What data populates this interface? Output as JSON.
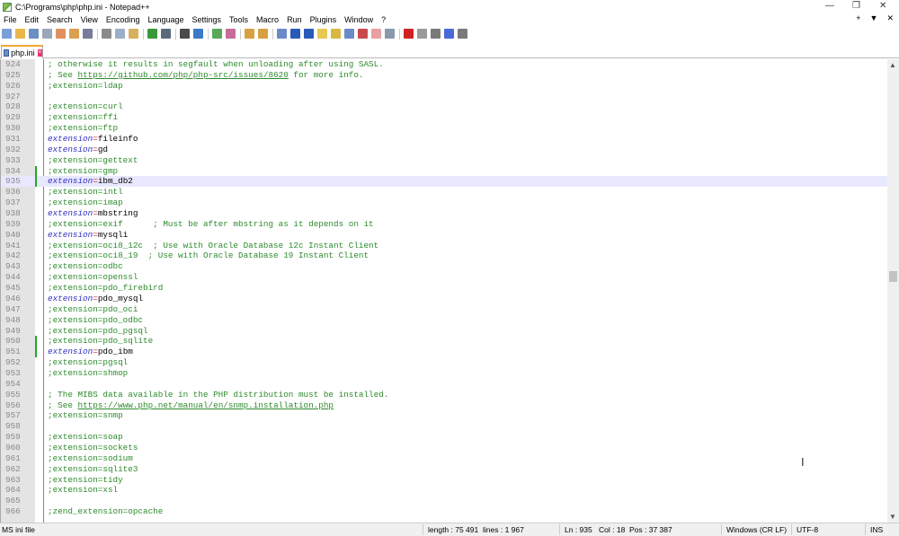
{
  "window": {
    "title": "C:\\Programs\\php\\php.ini - Notepad++",
    "controls": [
      "—",
      "❐",
      "✕"
    ]
  },
  "menu": {
    "items": [
      "File",
      "Edit",
      "Search",
      "View",
      "Encoding",
      "Language",
      "Settings",
      "Tools",
      "Macro",
      "Run",
      "Plugins",
      "Window",
      "?"
    ],
    "right": [
      "+",
      "▼",
      "✕"
    ]
  },
  "toolbar": {
    "icons": [
      "new-file",
      "open-file",
      "save",
      "save-all",
      "close",
      "close-all",
      "print",
      "|",
      "cut",
      "copy",
      "paste",
      "|",
      "undo",
      "redo",
      "|",
      "find",
      "replace",
      "|",
      "zoom-in",
      "zoom-out",
      "|",
      "sync-vertical",
      "sync-horizontal",
      "|",
      "word-wrap",
      "show-all-characters",
      "indent-guide",
      "user-defined-language",
      "document-map",
      "function-list",
      "folder-as-workspace",
      "document-list",
      "monitoring",
      "|",
      "record-macro",
      "stop-recording",
      "playback-macro",
      "run-macro-multiple",
      "save-macro"
    ]
  },
  "tab": {
    "label": "php.ini"
  },
  "editor": {
    "current_line": 935,
    "lines": [
      {
        "n": "924",
        "kind": "comment",
        "text": "; otherwise it results in segfault when unloading after using SASL."
      },
      {
        "n": "925",
        "kind": "comment_url",
        "pre": "; See ",
        "url": "https://github.com/php/php-src/issues/8620",
        "post": " for more info."
      },
      {
        "n": "926",
        "kind": "comment",
        "text": ";extension=ldap"
      },
      {
        "n": "927",
        "kind": "blank",
        "text": ""
      },
      {
        "n": "928",
        "kind": "comment",
        "text": ";extension=curl"
      },
      {
        "n": "929",
        "kind": "comment",
        "text": ";extension=ffi"
      },
      {
        "n": "930",
        "kind": "comment",
        "text": ";extension=ftp"
      },
      {
        "n": "931",
        "kind": "active",
        "key": "extension",
        "value": "fileinfo"
      },
      {
        "n": "932",
        "kind": "active",
        "key": "extension",
        "value": "gd"
      },
      {
        "n": "933",
        "kind": "comment",
        "text": ";extension=gettext"
      },
      {
        "n": "934",
        "kind": "comment",
        "text": ";extension=gmp",
        "changed": true
      },
      {
        "n": "935",
        "kind": "active",
        "key": "extension",
        "value": "ibm_db2",
        "changed": true
      },
      {
        "n": "936",
        "kind": "comment",
        "text": ";extension=intl"
      },
      {
        "n": "937",
        "kind": "comment",
        "text": ";extension=imap"
      },
      {
        "n": "938",
        "kind": "active",
        "key": "extension",
        "value": "mbstring"
      },
      {
        "n": "939",
        "kind": "comment",
        "text": ";extension=exif      ; Must be after mbstring as it depends on it"
      },
      {
        "n": "940",
        "kind": "active",
        "key": "extension",
        "value": "mysqli"
      },
      {
        "n": "941",
        "kind": "comment",
        "text": ";extension=oci8_12c  ; Use with Oracle Database 12c Instant Client"
      },
      {
        "n": "942",
        "kind": "comment",
        "text": ";extension=oci8_19  ; Use with Oracle Database 19 Instant Client"
      },
      {
        "n": "943",
        "kind": "comment",
        "text": ";extension=odbc"
      },
      {
        "n": "944",
        "kind": "comment",
        "text": ";extension=openssl"
      },
      {
        "n": "945",
        "kind": "comment",
        "text": ";extension=pdo_firebird"
      },
      {
        "n": "946",
        "kind": "active",
        "key": "extension",
        "value": "pdo_mysql"
      },
      {
        "n": "947",
        "kind": "comment",
        "text": ";extension=pdo_oci"
      },
      {
        "n": "948",
        "kind": "comment",
        "text": ";extension=pdo_odbc"
      },
      {
        "n": "949",
        "kind": "comment",
        "text": ";extension=pdo_pgsql"
      },
      {
        "n": "950",
        "kind": "comment",
        "text": ";extension=pdo_sqlite",
        "changed": true
      },
      {
        "n": "951",
        "kind": "active",
        "key": "extension",
        "value": "pdo_ibm",
        "changed": true
      },
      {
        "n": "952",
        "kind": "comment",
        "text": ";extension=pgsql"
      },
      {
        "n": "953",
        "kind": "comment",
        "text": ";extension=shmop"
      },
      {
        "n": "954",
        "kind": "blank",
        "text": ""
      },
      {
        "n": "955",
        "kind": "comment",
        "text": "; The MIBS data available in the PHP distribution must be installed."
      },
      {
        "n": "956",
        "kind": "comment_url",
        "pre": "; See ",
        "url": "https://www.php.net/manual/en/snmp.installation.php",
        "post": ""
      },
      {
        "n": "957",
        "kind": "comment",
        "text": ";extension=snmp"
      },
      {
        "n": "958",
        "kind": "blank",
        "text": ""
      },
      {
        "n": "959",
        "kind": "comment",
        "text": ";extension=soap"
      },
      {
        "n": "960",
        "kind": "comment",
        "text": ";extension=sockets"
      },
      {
        "n": "961",
        "kind": "comment",
        "text": ";extension=sodium"
      },
      {
        "n": "962",
        "kind": "comment",
        "text": ";extension=sqlite3"
      },
      {
        "n": "963",
        "kind": "comment",
        "text": ";extension=tidy"
      },
      {
        "n": "964",
        "kind": "comment",
        "text": ";extension=xsl"
      },
      {
        "n": "965",
        "kind": "blank",
        "text": ""
      },
      {
        "n": "966",
        "kind": "comment",
        "text": ";zend_extension=opcache"
      }
    ]
  },
  "status": {
    "file_type": "MS ini file",
    "length": "length : 75 491",
    "lines": "lines : 1 967",
    "ln": "Ln : 935",
    "col": "Col : 18",
    "pos": "Pos : 37 387",
    "eol": "Windows (CR LF)",
    "encoding": "UTF-8",
    "mode": "INS"
  },
  "colors": {
    "comment": "#2e8b2e",
    "keyword": "#3030c0",
    "current_line": "#e8e8ff",
    "edge": "#e06060",
    "change_marker": "#22aa22",
    "tab_accent": "#f3a936"
  }
}
